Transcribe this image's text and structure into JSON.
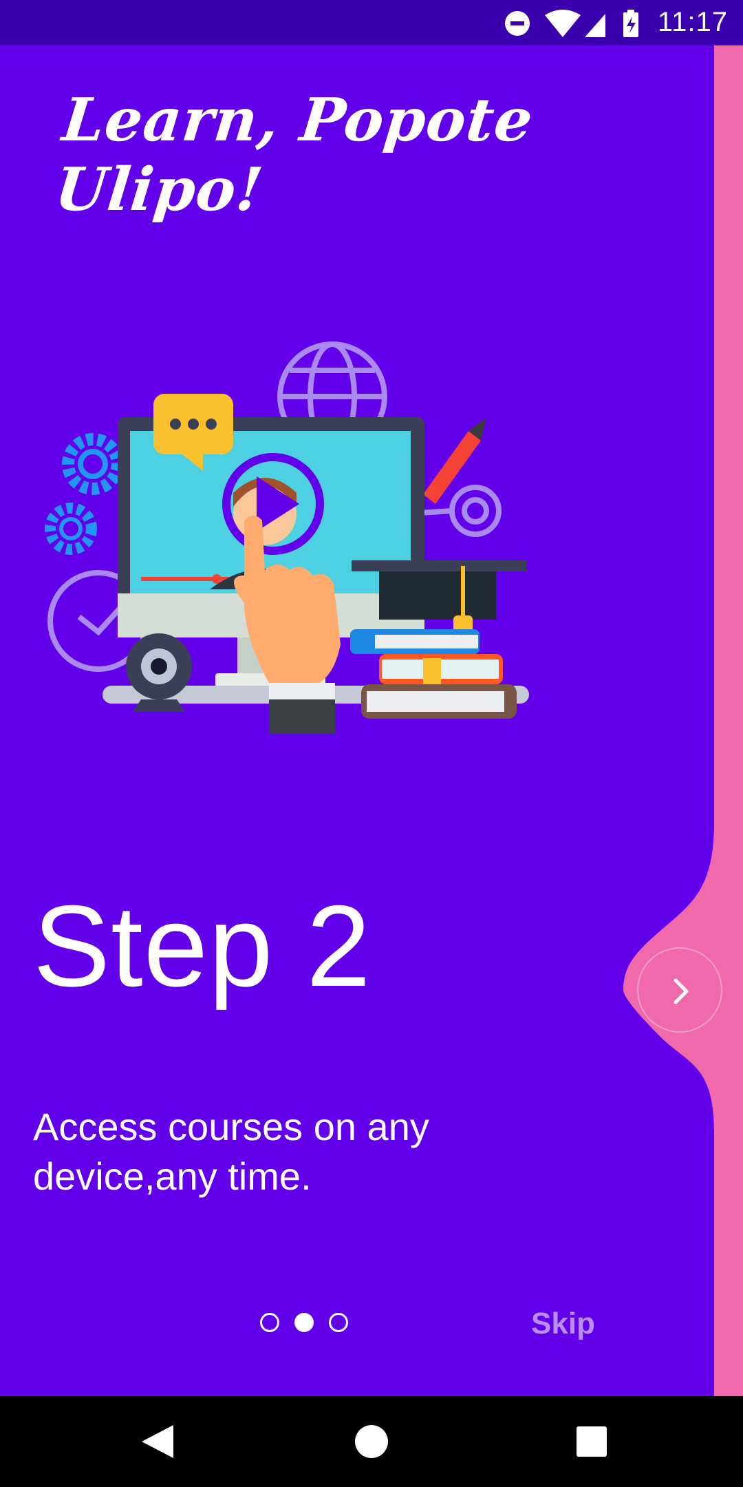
{
  "status_bar": {
    "time": "11:17",
    "icons": [
      "do-not-disturb-icon",
      "wifi-icon",
      "signal-icon",
      "battery-charging-icon"
    ]
  },
  "header": {
    "app_title": "Learn, Popote Ulipo!"
  },
  "illustration": {
    "name": "online-learning-illustration"
  },
  "onboarding": {
    "step_title": "Step 2",
    "description": "Access courses on any device,any time.",
    "pages_total": 3,
    "current_page": 2,
    "skip_label": "Skip",
    "next_icon": "chevron-right-icon"
  },
  "nav_bar": {
    "buttons": [
      "back-icon",
      "home-icon",
      "recents-icon"
    ]
  },
  "colors": {
    "background": "#6200EA",
    "status_bar": "#3A00AE",
    "accent_pink": "#F06AAB",
    "text": "#FFFFFF"
  }
}
